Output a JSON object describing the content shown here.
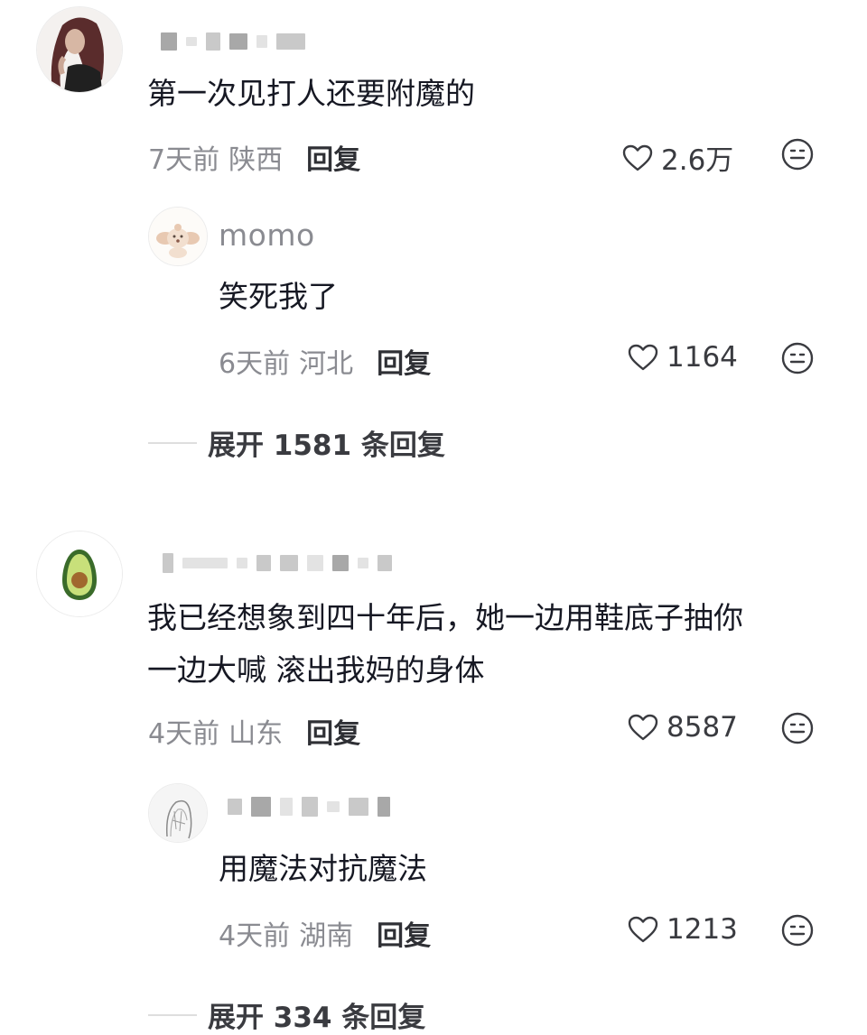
{
  "comments": [
    {
      "avatar_icon": "girl-avatar-icon",
      "text": "第一次见打人还要附魔的",
      "time": "7天前",
      "location": "陕西",
      "reply_label": "回复",
      "likes": "2.6万",
      "replies": [
        {
          "avatar_icon": "plush-dog-avatar-icon",
          "username": "momo",
          "text": "笑死我了",
          "time": "6天前",
          "location": "河北",
          "reply_label": "回复",
          "likes": "1164"
        }
      ],
      "expand_label": "展开 1581 条回复"
    },
    {
      "avatar_icon": "avocado-avatar-icon",
      "text_line1": "我已经想象到四十年后，她一边用鞋底子抽你",
      "text_line2": "一边大喊 滚出我妈的身体",
      "time": "4天前",
      "location": "山东",
      "reply_label": "回复",
      "likes": "8587",
      "replies": [
        {
          "avatar_icon": "sketch-avatar-icon",
          "text": "用魔法对抗魔法",
          "time": "4天前",
          "location": "湖南",
          "reply_label": "回复",
          "likes": "1213"
        }
      ],
      "expand_label": "展开 334 条回复"
    }
  ],
  "icons": {
    "like": "heart-outline-icon",
    "emoji": "emoji-face-icon"
  },
  "colors": {
    "text": "#161823",
    "meta": "#8a8b91",
    "reply": "#2f3035"
  }
}
